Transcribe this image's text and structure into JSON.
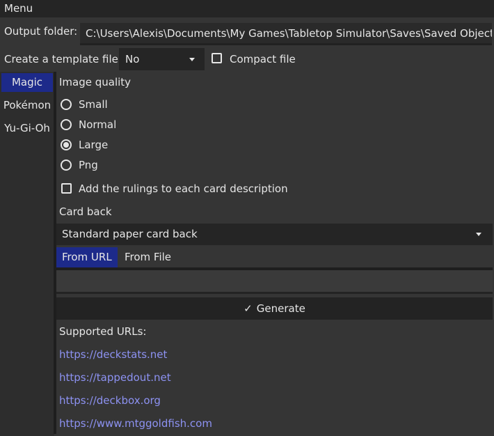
{
  "menu": {
    "label": "Menu"
  },
  "output": {
    "label": "Output folder:",
    "value": "C:\\Users\\Alexis\\Documents\\My Games\\Tabletop Simulator\\Saves\\Saved Objects"
  },
  "template": {
    "label": "Create a template file:",
    "selected": "No",
    "compact_label": "Compact file",
    "compact_checked": false
  },
  "sidebar": {
    "items": [
      {
        "label": "Magic",
        "active": true
      },
      {
        "label": "Pokémon",
        "active": false
      },
      {
        "label": "Yu-Gi-Oh",
        "active": false
      }
    ]
  },
  "quality": {
    "label": "Image quality",
    "options": [
      "Small",
      "Normal",
      "Large",
      "Png"
    ],
    "selected": "Large"
  },
  "rulings": {
    "label": "Add the rulings to each card description",
    "checked": false
  },
  "card_back": {
    "label": "Card back",
    "selected": "Standard paper card back"
  },
  "source_tabs": {
    "tabs": [
      "From URL",
      "From File"
    ],
    "active": "From URL"
  },
  "url_input": {
    "value": "",
    "placeholder": ""
  },
  "generate": {
    "label": "Generate",
    "icon": "check-icon"
  },
  "supported": {
    "label": "Supported URLs:",
    "links": [
      "https://deckstats.net",
      "https://tappedout.net",
      "https://deckbox.org",
      "https://www.mtggoldfish.com"
    ]
  },
  "colors": {
    "accent": "#1d2a8a",
    "link": "#8d92f2",
    "background": "#353535"
  }
}
